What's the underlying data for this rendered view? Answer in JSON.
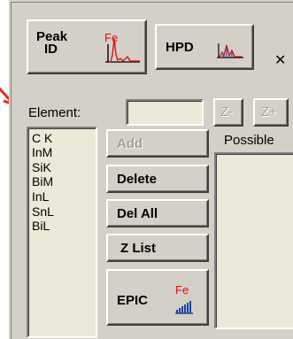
{
  "toolbar": {
    "peak_id_line1": "Peak",
    "peak_id_line2": "ID",
    "peak_id_icon_text": "Fe",
    "hpd_label": "HPD",
    "close_glyph": "✕"
  },
  "element": {
    "label": "Element:",
    "value": "",
    "z_minus": "Z-",
    "z_plus": "Z+"
  },
  "element_list": [
    "C K",
    "InM",
    "SiK",
    "BiM",
    "InL",
    "SnL",
    "BiL"
  ],
  "actions": {
    "add": "Add",
    "delete": "Delete",
    "del_all": "Del All",
    "z_list": "Z List",
    "epic": "EPIC",
    "epic_icon_text": "Fe"
  },
  "possible": {
    "label": "Possible"
  },
  "colors": {
    "panel": "#d4d0c8",
    "arrow": "#e03010",
    "fe_text": "#d01010",
    "peak_red": "#e01010"
  }
}
